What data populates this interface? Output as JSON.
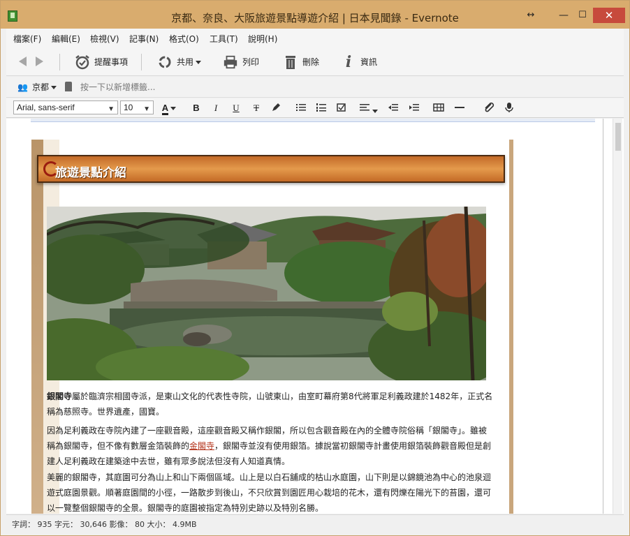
{
  "window": {
    "title": "京都、奈良、大阪旅遊景點導遊介紹 | 日本見聞錄 - Evernote",
    "resize_icon": "↔",
    "minimize_icon": "—",
    "maximize_icon": "☐",
    "close_icon": "✕"
  },
  "menu": {
    "items": [
      "檔案(F)",
      "編輯(E)",
      "檢視(V)",
      "記事(N)",
      "格式(O)",
      "工具(T)",
      "說明(H)"
    ]
  },
  "toolbar": {
    "reminder_label": "提醒事項",
    "share_label": "共用",
    "print_label": "列印",
    "delete_label": "刪除",
    "info_label": "資訊"
  },
  "tags": {
    "notebook": "京都",
    "placeholder": "按一下以新增標籤..."
  },
  "format": {
    "font": "Arial, sans-serif",
    "size": "10"
  },
  "note": {
    "section_title": "旅遊景點介紹",
    "p1_keyword": "銀閣寺",
    "p1_text": "屬於臨濟宗相國寺派，是東山文化的代表性寺院，山號東山，由室町幕府第8代將軍足利義政建於1482年，正式名稱為慈照寺。世界遺產，國寶。",
    "p2_before": "因為足利義政在寺院內建了一座觀音殿，這座觀音殿又稱作銀閣，所以包含觀音殿在內的全體寺院俗稱「銀閣寺」。雖被稱為銀閣寺，但不像有數層金箔裝飾的",
    "p2_link": "金閣寺",
    "p2_after": "，銀閣寺並沒有使用銀箔。據說當初銀閣寺計畫使用銀箔裝飾觀音殿但是創建人足利義政在建築途中去世，雖有眾多說法但沒有人知道真情。",
    "p3_text": "美麗的銀閣寺，其庭園可分為山上和山下兩個區域。山上是以白石舖成的枯山水庭園，山下則是以錦鏡池為中心的池泉迴遊式庭園景觀。順著庭園間的小徑，一路散步到後山，不只欣賞到園匠用心栽培的花木，還有閃爍在陽光下的苔園，還可以一覽整個銀閣寺的全景。銀閣寺的庭園被指定為特別史跡以及特別名勝。"
  },
  "status": {
    "text": "字詞： 935  字元： 30,646  影像： 80  大小： 4.9MB"
  }
}
